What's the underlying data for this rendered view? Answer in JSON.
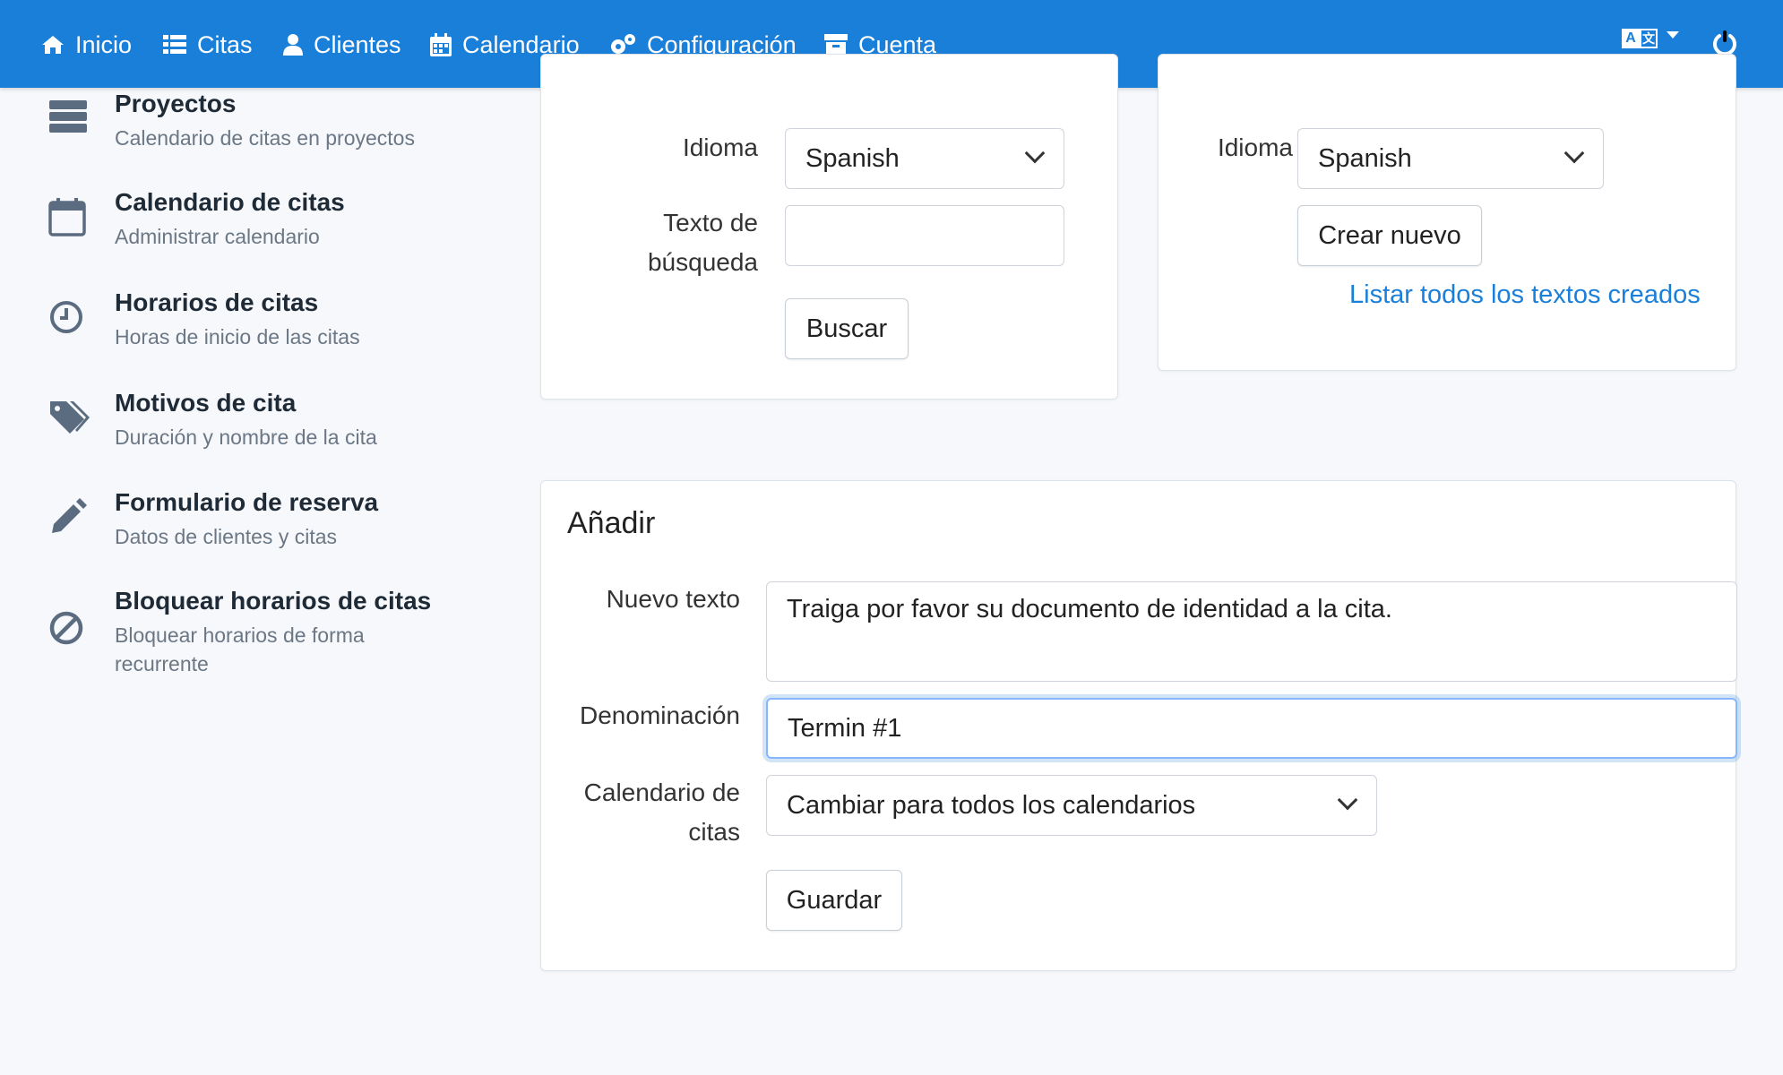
{
  "nav": {
    "items": [
      {
        "label": "Inicio",
        "icon": "home-icon"
      },
      {
        "label": "Citas",
        "icon": "list-icon"
      },
      {
        "label": "Clientes",
        "icon": "user-icon"
      },
      {
        "label": "Calendario",
        "icon": "calendar-icon"
      },
      {
        "label": "Configuración",
        "icon": "gears-icon"
      },
      {
        "label": "Cuenta",
        "icon": "archive-icon"
      }
    ],
    "lang_icon_left": "A",
    "lang_icon_right": "文",
    "bg_color": "#1a7fd9"
  },
  "sidebar": {
    "items": [
      {
        "title": "Proyectos",
        "sub": "Calendario de citas en proyectos",
        "icon": "server-stack-icon"
      },
      {
        "title": "Calendario de citas",
        "sub": "Administrar calendario",
        "icon": "calendar-icon"
      },
      {
        "title": "Horarios de citas",
        "sub": "Horas de inicio de las citas",
        "icon": "clock-icon"
      },
      {
        "title": "Motivos de cita",
        "sub": "Duración y nombre de la cita",
        "icon": "tags-icon"
      },
      {
        "title": "Formulario de reserva",
        "sub": "Datos de clientes y citas",
        "icon": "pencil-icon"
      },
      {
        "title": "Bloquear horarios de citas",
        "sub": "Bloquear horarios de forma recurrente",
        "icon": "ban-icon"
      }
    ]
  },
  "search_card": {
    "language_label": "Idioma",
    "language_value": "Spanish",
    "search_label": "Texto de búsqueda",
    "search_value": "",
    "search_button": "Buscar"
  },
  "create_card": {
    "language_label": "Idioma",
    "language_value": "Spanish",
    "create_button": "Crear nuevo",
    "list_link": "Listar todos los textos creados"
  },
  "add_card": {
    "title": "Añadir",
    "new_text_label": "Nuevo texto",
    "new_text_value": "Traiga por favor su documento de identidad a la cita.",
    "name_label": "Denominación",
    "name_value": "Termin #1",
    "calendar_label": "Calendario de citas",
    "calendar_value": "Cambiar para todos los calendarios",
    "save_button": "Guardar"
  }
}
